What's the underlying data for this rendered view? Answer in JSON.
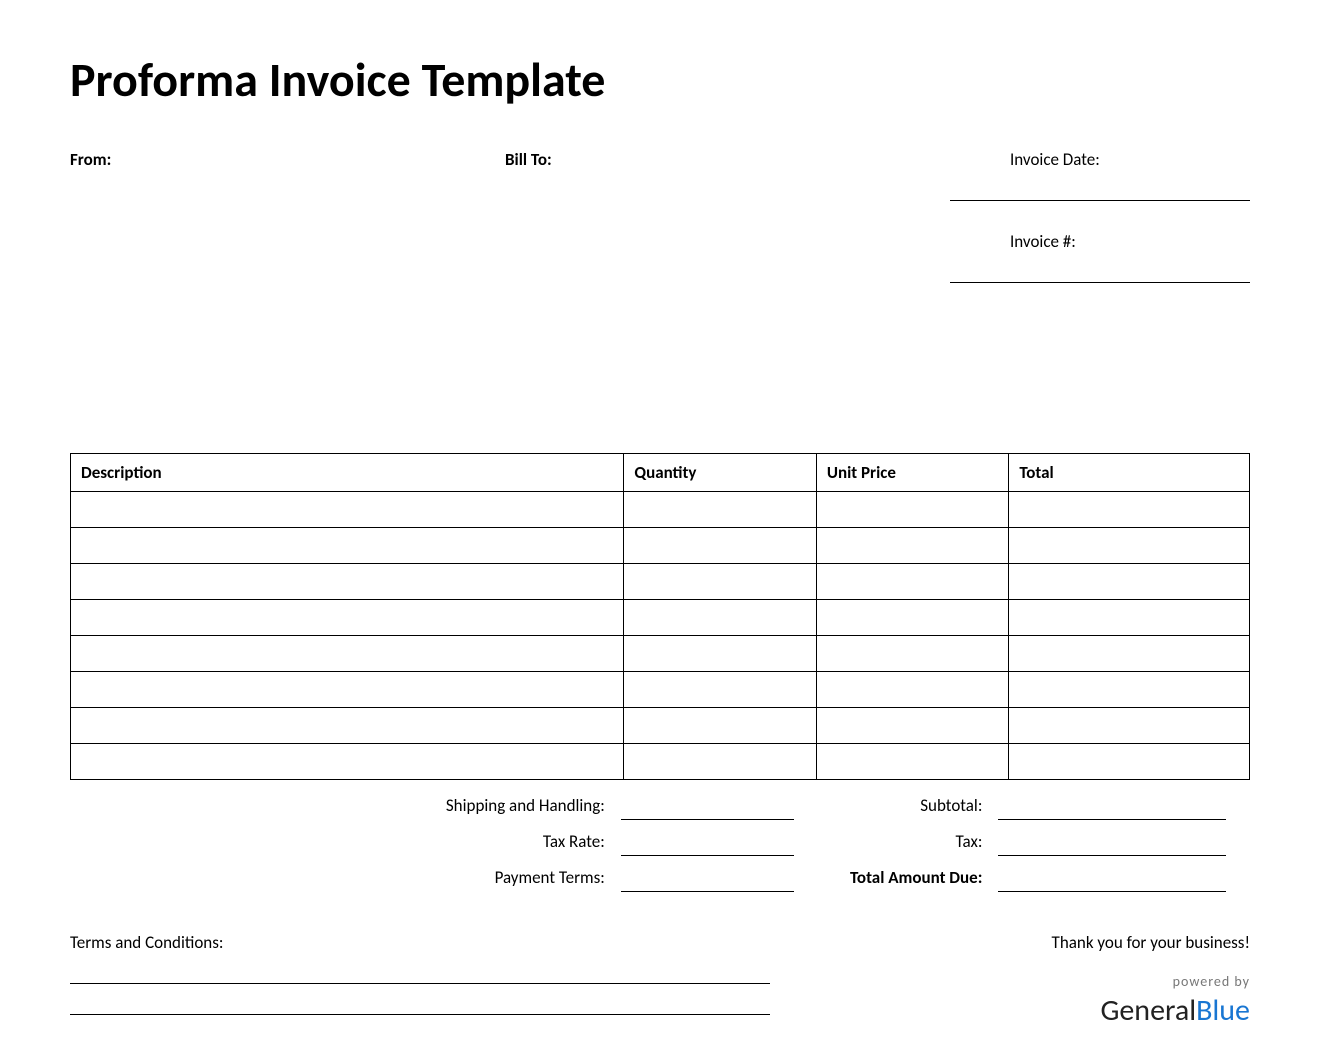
{
  "title": "Proforma Invoice Template",
  "labels": {
    "from": "From:",
    "bill_to": "Bill To:",
    "invoice_date": "Invoice Date:",
    "invoice_number": "Invoice #:"
  },
  "columns": {
    "description": "Description",
    "quantity": "Quantity",
    "unit_price": "Unit Price",
    "total": "Total"
  },
  "line_items": [
    {
      "description": "",
      "quantity": "",
      "unit_price": "",
      "total": ""
    },
    {
      "description": "",
      "quantity": "",
      "unit_price": "",
      "total": ""
    },
    {
      "description": "",
      "quantity": "",
      "unit_price": "",
      "total": ""
    },
    {
      "description": "",
      "quantity": "",
      "unit_price": "",
      "total": ""
    },
    {
      "description": "",
      "quantity": "",
      "unit_price": "",
      "total": ""
    },
    {
      "description": "",
      "quantity": "",
      "unit_price": "",
      "total": ""
    },
    {
      "description": "",
      "quantity": "",
      "unit_price": "",
      "total": ""
    },
    {
      "description": "",
      "quantity": "",
      "unit_price": "",
      "total": ""
    }
  ],
  "summary": {
    "shipping_label": "Shipping and Handling:",
    "tax_rate_label": "Tax Rate:",
    "payment_terms_label": "Payment Terms:",
    "subtotal_label": "Subtotal:",
    "tax_label": "Tax:",
    "total_due_label": "Total Amount Due:",
    "shipping": "",
    "tax_rate": "",
    "payment_terms": "",
    "subtotal": "",
    "tax": "",
    "total_due": ""
  },
  "footer": {
    "terms_label": "Terms and Conditions:",
    "thank_you": "Thank you for your business!",
    "powered_by": "powered by",
    "brand_general": "General",
    "brand_blue": "Blue"
  }
}
